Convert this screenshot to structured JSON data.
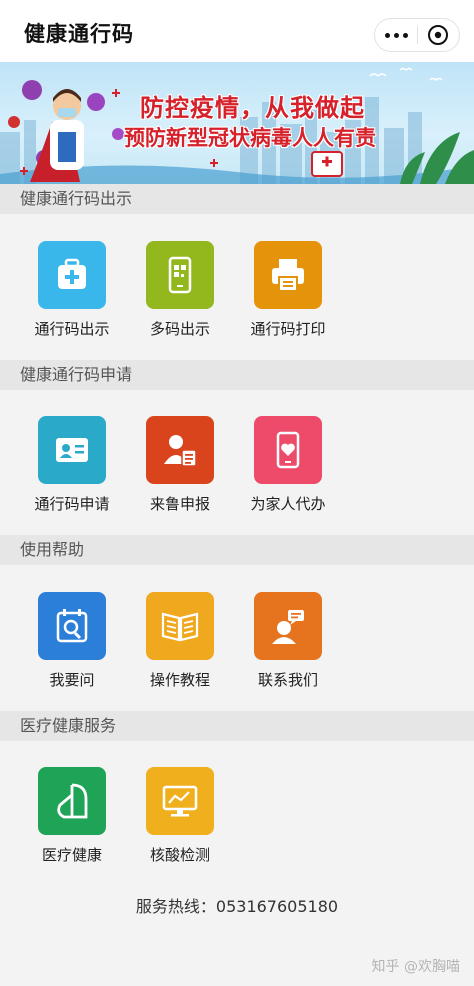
{
  "app": {
    "title": "健康通行码"
  },
  "capsule": {
    "more_icon": "more-dots-icon",
    "close_icon": "close-circle-icon"
  },
  "banner": {
    "line1": "防控疫情，从我做起",
    "line2": "预防新型冠状病毒人人有责"
  },
  "sections": [
    {
      "title": "健康通行码出示",
      "items": [
        {
          "label": "通行码出示",
          "icon": "medical-kit-icon",
          "color": "#3ab7ea"
        },
        {
          "label": "多码出示",
          "icon": "phone-qr-icon",
          "color": "#93b81e"
        },
        {
          "label": "通行码打印",
          "icon": "printer-icon",
          "color": "#e6930c"
        }
      ]
    },
    {
      "title": "健康通行码申请",
      "items": [
        {
          "label": "通行码申请",
          "icon": "id-card-icon",
          "color": "#2ba9c9"
        },
        {
          "label": "来鲁申报",
          "icon": "person-document-icon",
          "color": "#d9441d"
        },
        {
          "label": "为家人代办",
          "icon": "phone-heart-icon",
          "color": "#ee4b6b"
        }
      ]
    },
    {
      "title": "使用帮助",
      "items": [
        {
          "label": "我要问",
          "icon": "calendar-search-icon",
          "color": "#2b7fd9"
        },
        {
          "label": "操作教程",
          "icon": "open-book-icon",
          "color": "#f0a81e"
        },
        {
          "label": "联系我们",
          "icon": "support-agent-icon",
          "color": "#e6731e"
        }
      ]
    },
    {
      "title": "医疗健康服务",
      "items": [
        {
          "label": "医疗健康",
          "icon": "health-logo-icon",
          "color": "#1fa457"
        },
        {
          "label": "核酸检测",
          "icon": "monitor-chart-icon",
          "color": "#f0b01e"
        }
      ]
    }
  ],
  "footer": {
    "hotline": "服务热线：053167605180"
  },
  "watermark": {
    "text": "知乎 @欢胸喵"
  }
}
